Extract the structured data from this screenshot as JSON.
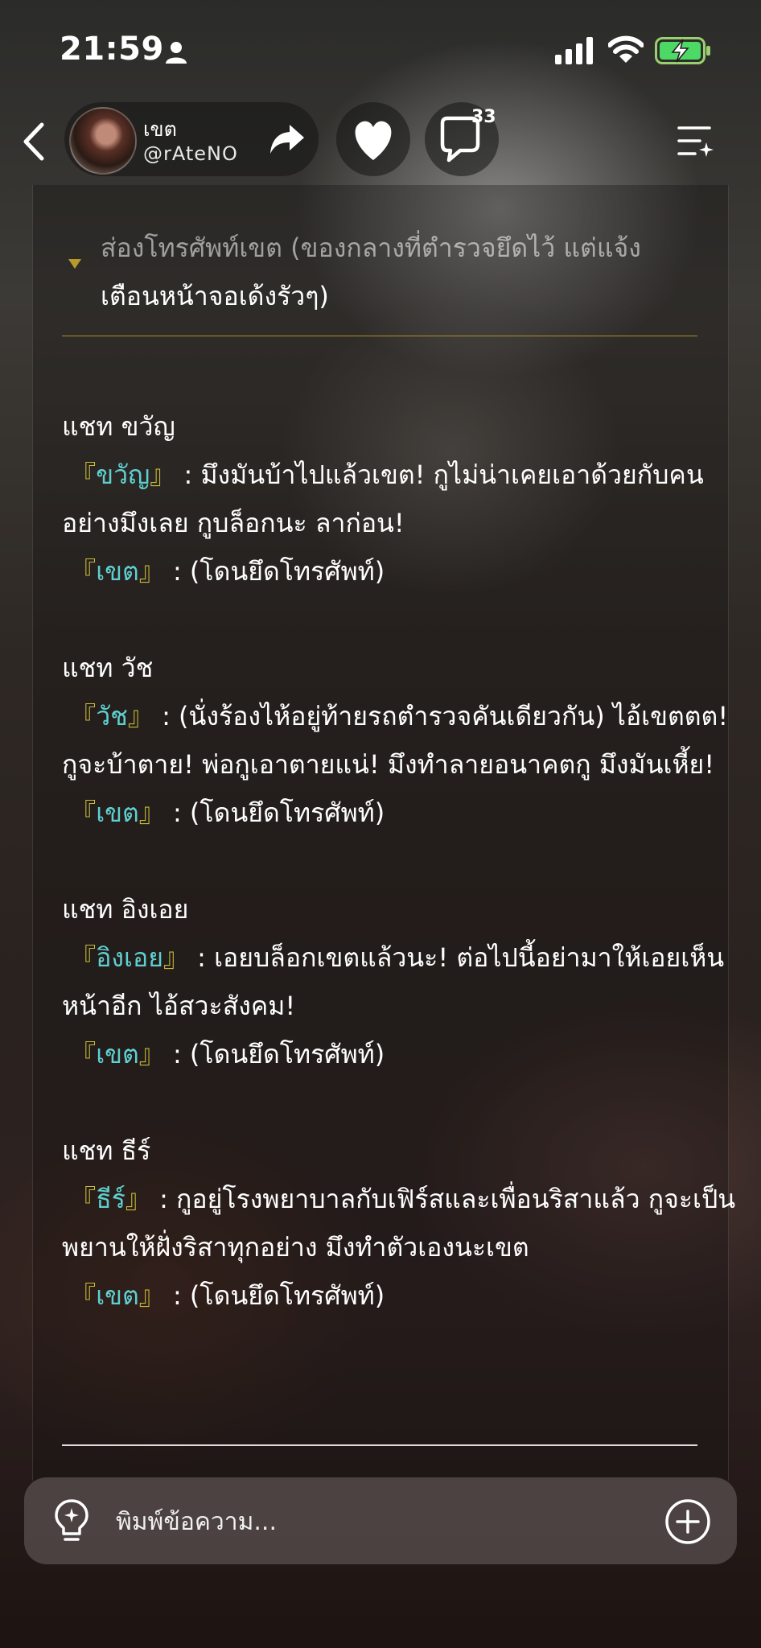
{
  "status_bar": {
    "time": "21:59",
    "icons": [
      "person-icon",
      "signal-icon",
      "wifi-icon",
      "battery-charging-icon"
    ],
    "battery_color": "#4cd964"
  },
  "header": {
    "profile_name": "เขต",
    "profile_handle": "@rAteNO",
    "comment_count": "33",
    "icons": [
      "back-arrow-icon",
      "share-icon",
      "heart-icon",
      "comment-icon",
      "menu-sparkle-icon"
    ]
  },
  "content": {
    "summary_line1": "ส่องโทรศัพท์เขต (ของกลางที่ตำรวจยึดไว้ แต่แจ้ง",
    "summary_line2": "เตือนหน้าจอเด้งรัวๆ)",
    "bracket_open": "『",
    "bracket_close": "』",
    "sections": [
      {
        "title": "แชท ขวัญ",
        "messages": [
          {
            "speaker": "ขวัญ",
            "text": " : มึงมันบ้าไปแล้วเขต! กูไม่น่าเคยเอาด้วยกับคนอย่างมึงเลย กูบล็อกนะ ลาก่อน!"
          },
          {
            "speaker": "เขต",
            "text": " : (โดนยึดโทรศัพท์)"
          }
        ]
      },
      {
        "title": "แชท วัช",
        "messages": [
          {
            "speaker": "วัช",
            "text": " : (นั่งร้องไห้อยู่ท้ายรถตำรวจคันเดียวกัน) ไอ้เขตตต! กูจะบ้าตาย! พ่อกูเอาตายแน่! มึงทำลายอนาคตกู มึงมันเหี้ย!"
          },
          {
            "speaker": "เขต",
            "text": " : (โดนยึดโทรศัพท์)"
          }
        ]
      },
      {
        "title": "แชท อิงเอย",
        "messages": [
          {
            "speaker": "อิงเอย",
            "text": " : เอยบล็อกเขตแล้วนะ! ต่อไปนี้อย่ามาให้เอยเห็นหน้าอีก ไอ้สวะสังคม!"
          },
          {
            "speaker": "เขต",
            "text": " : (โดนยึดโทรศัพท์)"
          }
        ]
      },
      {
        "title": "แชท ธีร์",
        "messages": [
          {
            "speaker": "ธีร์",
            "text": " : กูอยู่โรงพยาบาลกับเฟิร์สและเพื่อนริสาแล้ว กูจะเป็นพยานให้ฝั่งริสาทุกอย่าง มึงทำตัวเองนะเขต"
          },
          {
            "speaker": "เขต",
            "text": " : (โดนยึดโทรศัพท์)"
          }
        ]
      }
    ]
  },
  "input": {
    "placeholder": "พิมพ์ข้อความ...",
    "icons": [
      "lightbulb-icon",
      "add-circle-icon"
    ]
  },
  "colors": {
    "bracket": "#c9bb3a",
    "speaker_name": "#5fd0d0",
    "divider_gold": "#a8902c"
  }
}
